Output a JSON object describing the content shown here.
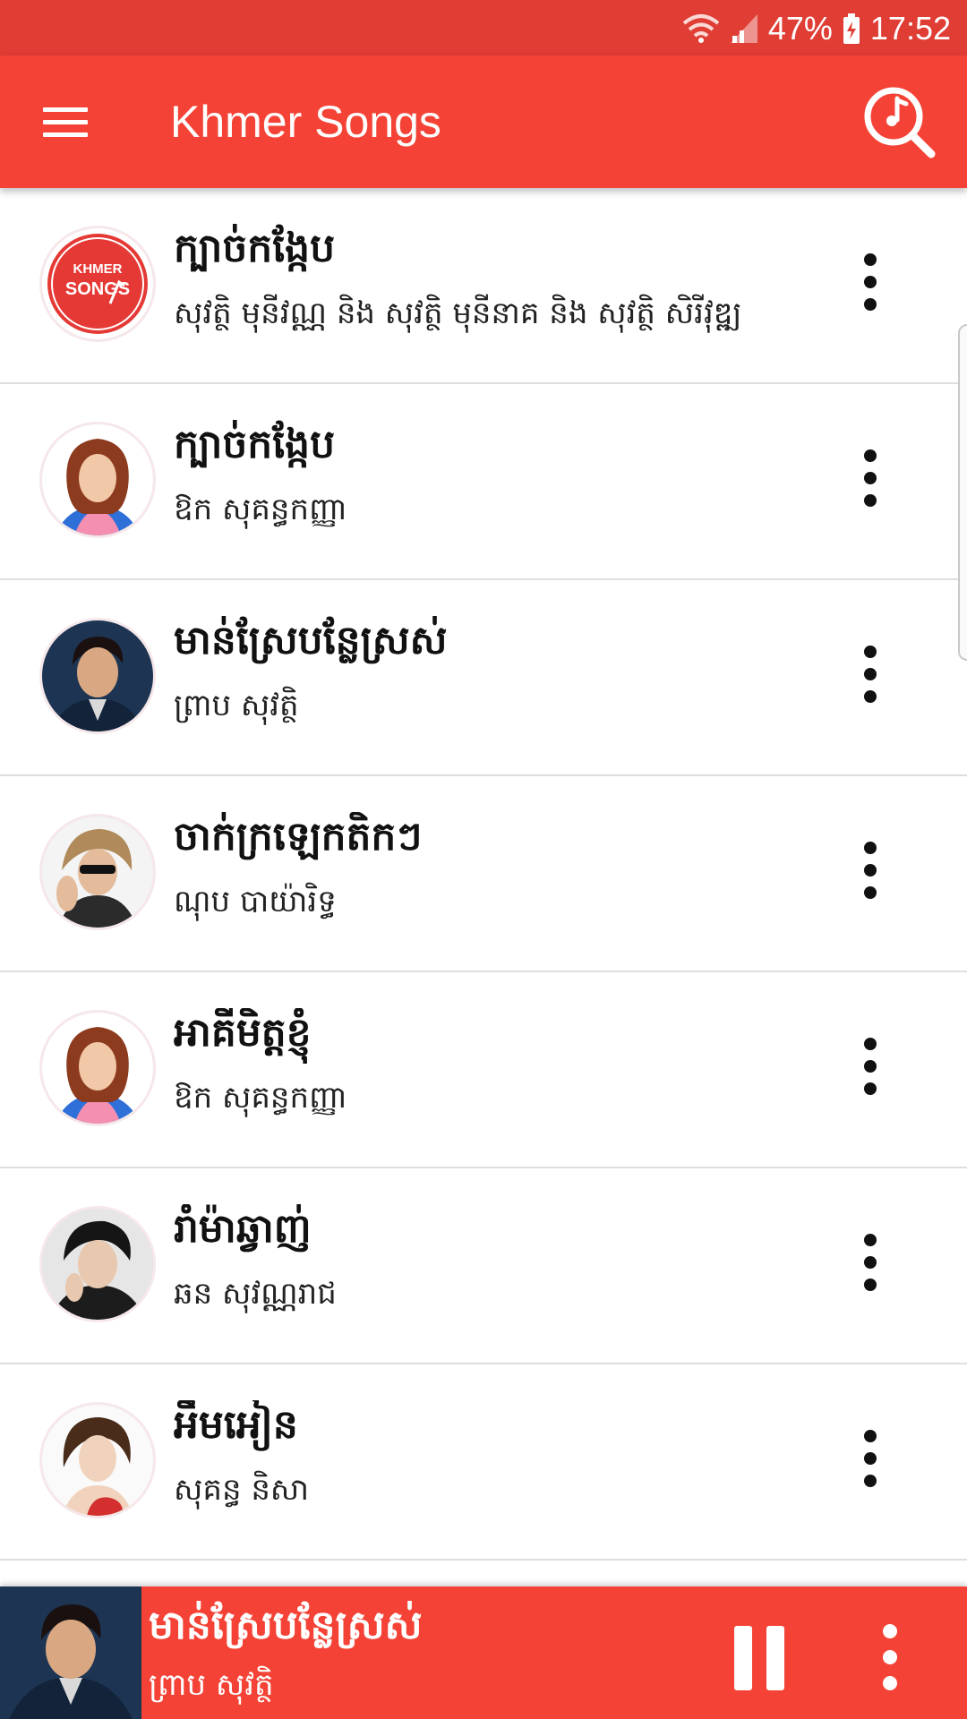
{
  "status_bar": {
    "battery": "47%",
    "time": "17:52",
    "icons": [
      "wifi-icon",
      "signal-icon",
      "battery-charging-icon"
    ]
  },
  "app_bar": {
    "title": "Khmer Songs",
    "menu_icon": "hamburger-menu-icon",
    "search_icon": "search-icon"
  },
  "logo": {
    "line1": "KHMER",
    "line2": "SONGS"
  },
  "songs": [
    {
      "title": "ក្បាច់កង្កែប",
      "artist": "សុវត្ថិ មុនីវណ្ណ និង សុវត្ថិ មុនីនាគ និង សុវត្ថិ សិរីវុឌ្ឍ"
    },
    {
      "title": "ក្បាច់កង្កែប",
      "artist": "ឱក សុគន្ធកញ្ញា"
    },
    {
      "title": "មាន់ស្រែបន្លែស្រស់",
      "artist": "ព្រាប សុវត្ថិ"
    },
    {
      "title": "ចាក់ក្រឡេកតិកៗ",
      "artist": "ណុប បាយ៉ារិទ្ធ"
    },
    {
      "title": "អាគីមិត្តខ្ញុំ",
      "artist": "ឱក សុគន្ធកញ្ញា"
    },
    {
      "title": "រាំម៉ាឆ្វាញ់",
      "artist": "ឆន សុវណ្ណរាជ"
    },
    {
      "title": "អឹមអៀន",
      "artist": "សុគន្ធ និសា"
    }
  ],
  "now_playing": {
    "title": "មាន់ស្រែបន្លែស្រស់",
    "artist": "ព្រាប សុវត្ថិ",
    "pause_icon": "pause-icon",
    "more_icon": "more-vert-icon"
  },
  "colors": {
    "primary": "#f44336",
    "status_bar": "#e03d35",
    "divider": "#dedede"
  }
}
